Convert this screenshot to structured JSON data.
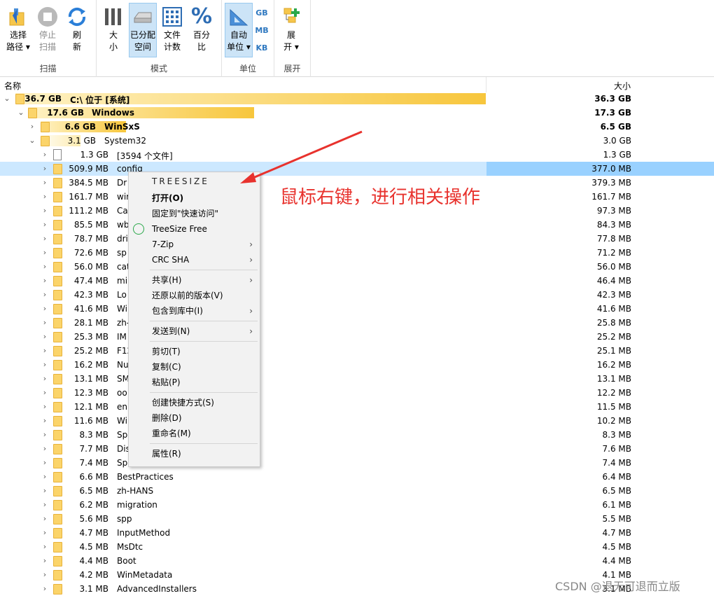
{
  "ribbon": {
    "groups": {
      "scan": "扫描",
      "mode": "模式",
      "unit": "单位",
      "expand": "展开"
    },
    "buttons": {
      "select_path": [
        "选择",
        "路径 ▾"
      ],
      "stop_scan": [
        "停止",
        "扫描"
      ],
      "refresh": [
        "刷",
        "新"
      ],
      "size": [
        "大",
        "小"
      ],
      "allocated": [
        "已分配",
        "空间"
      ],
      "file_count": [
        "文件",
        "计数"
      ],
      "percent": [
        "百分",
        "比"
      ],
      "auto_unit": [
        "自动",
        "单位 ▾"
      ],
      "expand": [
        "展",
        "开 ▾"
      ]
    },
    "units": [
      "GB",
      "MB",
      "KB"
    ],
    "percent_glyph": "%"
  },
  "columns": {
    "name": "名称",
    "size": "大小"
  },
  "rows": [
    {
      "size": "36.7 GB",
      "name": "C:\\  位于  [系统]",
      "right": "36.3 GB",
      "bold": true,
      "level": 0,
      "chev": "⌄",
      "bar": 672
    },
    {
      "size": "17.6 GB",
      "name": "Windows",
      "right": "17.3 GB",
      "bold": true,
      "level": 1,
      "chev": "⌄",
      "bar": 323
    },
    {
      "size": "6.6 GB",
      "name": "WinSxS",
      "right": "6.5 GB",
      "bold": true,
      "level": 2,
      "chev": "›",
      "bar": 122
    },
    {
      "size": "3.1 GB",
      "name": "System32",
      "right": "3.0 GB",
      "bold": false,
      "level": 2,
      "chev": "⌄",
      "bar": 57,
      "lite": true
    },
    {
      "size": "1.3 GB",
      "name": "[3594 个文件]",
      "right": "1.3 GB",
      "level": 3,
      "chev": "›",
      "file": true
    },
    {
      "size": "509.9 MB",
      "name": "config",
      "right": "377.0 MB",
      "level": 3,
      "chev": "›",
      "selected": true
    },
    {
      "size": "384.5 MB",
      "name": "Dr",
      "right": "379.3 MB",
      "level": 3,
      "chev": "›"
    },
    {
      "size": "161.7 MB",
      "name": "wir",
      "right": "161.7 MB",
      "level": 3,
      "chev": "›"
    },
    {
      "size": "111.2 MB",
      "name": "Ca",
      "right": "97.3 MB",
      "level": 3,
      "chev": "›"
    },
    {
      "size": "85.5 MB",
      "name": "wb",
      "right": "84.3 MB",
      "level": 3,
      "chev": "›"
    },
    {
      "size": "78.7 MB",
      "name": "dri",
      "right": "77.8 MB",
      "level": 3,
      "chev": "›"
    },
    {
      "size": "72.6 MB",
      "name": "sp",
      "right": "71.2 MB",
      "level": 3,
      "chev": "›"
    },
    {
      "size": "56.0 MB",
      "name": "cat",
      "right": "56.0 MB",
      "level": 3,
      "chev": "›"
    },
    {
      "size": "47.4 MB",
      "name": "mi",
      "right": "46.4 MB",
      "level": 3,
      "chev": "›"
    },
    {
      "size": "42.3 MB",
      "name": "Lo",
      "right": "42.3 MB",
      "level": 3,
      "chev": "›"
    },
    {
      "size": "41.6 MB",
      "name": "Wi",
      "right": "41.6 MB",
      "level": 3,
      "chev": "›"
    },
    {
      "size": "28.1 MB",
      "name": "zh-",
      "right": "25.8 MB",
      "level": 3,
      "chev": "›"
    },
    {
      "size": "25.3 MB",
      "name": "IM",
      "right": "25.2 MB",
      "level": 3,
      "chev": "›"
    },
    {
      "size": "25.2 MB",
      "name": "F12",
      "right": "25.1 MB",
      "level": 3,
      "chev": "›"
    },
    {
      "size": "16.2 MB",
      "name": "Nu",
      "right": "16.2 MB",
      "level": 3,
      "chev": "›"
    },
    {
      "size": "13.1 MB",
      "name": "SM",
      "right": "13.1 MB",
      "level": 3,
      "chev": "›"
    },
    {
      "size": "12.3 MB",
      "name": "oo",
      "right": "12.2 MB",
      "level": 3,
      "chev": "›"
    },
    {
      "size": "12.1 MB",
      "name": "en",
      "right": "11.5 MB",
      "level": 3,
      "chev": "›"
    },
    {
      "size": "11.6 MB",
      "name": "Wi",
      "right": "10.2 MB",
      "level": 3,
      "chev": "›"
    },
    {
      "size": "8.3 MB",
      "name": "Sp",
      "right": "8.3 MB",
      "level": 3,
      "chev": "›"
    },
    {
      "size": "7.7 MB",
      "name": "Dis",
      "right": "7.6 MB",
      "level": 3,
      "chev": "›"
    },
    {
      "size": "7.4 MB",
      "name": "Sp",
      "right": "7.4 MB",
      "level": 3,
      "chev": "›"
    },
    {
      "size": "6.6 MB",
      "name": "BestPractices",
      "right": "6.4 MB",
      "level": 3,
      "chev": "›"
    },
    {
      "size": "6.5 MB",
      "name": "zh-HANS",
      "right": "6.5 MB",
      "level": 3,
      "chev": "›"
    },
    {
      "size": "6.2 MB",
      "name": "migration",
      "right": "6.1 MB",
      "level": 3,
      "chev": "›"
    },
    {
      "size": "5.6 MB",
      "name": "spp",
      "right": "5.5 MB",
      "level": 3,
      "chev": "›"
    },
    {
      "size": "4.7 MB",
      "name": "InputMethod",
      "right": "4.7 MB",
      "level": 3,
      "chev": "›"
    },
    {
      "size": "4.5 MB",
      "name": "MsDtc",
      "right": "4.5 MB",
      "level": 3,
      "chev": "›"
    },
    {
      "size": "4.4 MB",
      "name": "Boot",
      "right": "4.4 MB",
      "level": 3,
      "chev": "›"
    },
    {
      "size": "4.2 MB",
      "name": "WinMetadata",
      "right": "4.1 MB",
      "level": 3,
      "chev": "›"
    },
    {
      "size": "3.1 MB",
      "name": "AdvancedInstallers",
      "right": "3.1 MB",
      "level": 3,
      "chev": "›"
    }
  ],
  "context_menu": {
    "header": "TREESIZE",
    "items": [
      {
        "label": "打开(O)",
        "bold": true
      },
      {
        "label": "固定到\"快速访问\""
      },
      {
        "label": "TreeSize Free",
        "icon": "treesize-icon"
      },
      {
        "label": "7-Zip",
        "submenu": true
      },
      {
        "label": "CRC SHA",
        "submenu": true
      },
      {
        "sep": true
      },
      {
        "label": "共享(H)",
        "submenu": true
      },
      {
        "label": "还原以前的版本(V)"
      },
      {
        "label": "包含到库中(I)",
        "submenu": true
      },
      {
        "sep": true
      },
      {
        "label": "发送到(N)",
        "submenu": true
      },
      {
        "sep": true
      },
      {
        "label": "剪切(T)"
      },
      {
        "label": "复制(C)"
      },
      {
        "label": "粘贴(P)"
      },
      {
        "sep": true
      },
      {
        "label": "创建快捷方式(S)"
      },
      {
        "label": "删除(D)"
      },
      {
        "label": "重命名(M)"
      },
      {
        "sep": true
      },
      {
        "label": "属性(R)"
      }
    ]
  },
  "annotation": "鼠标右键，进行相关操作",
  "watermark": "CSDN @退无可退而立版",
  "colors": {
    "accent": "#e8322d",
    "selection": "#cce8ff",
    "selection_right": "#99d1ff",
    "folder": "#fbd46a"
  }
}
